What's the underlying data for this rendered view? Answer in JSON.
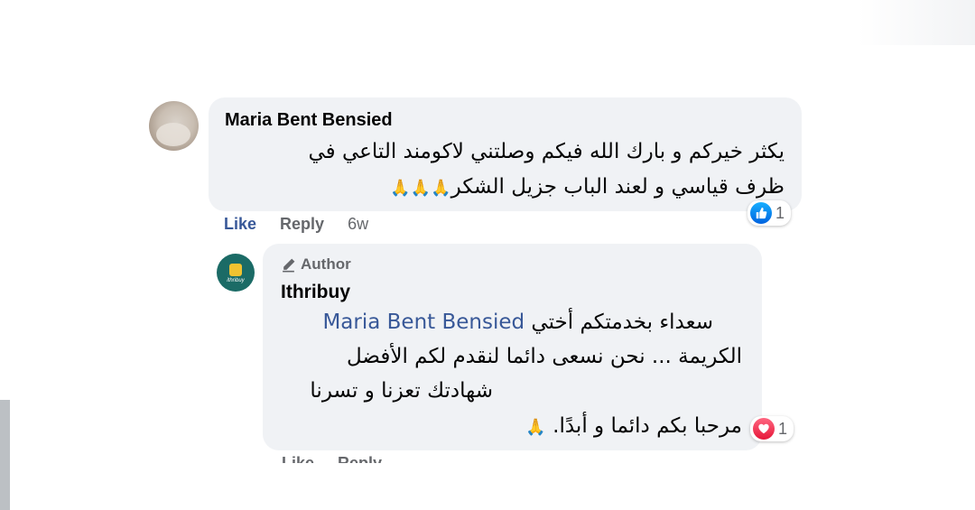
{
  "comments": [
    {
      "author": "Maria Bent Bensied",
      "lines": [
        "يكثر خيركم و بارك الله فيكم وصلتني لاكومند التاعي في",
        "ظرف قياسي و لعند الباب جزيل الشكر"
      ],
      "emoji": "🙏🙏🙏",
      "actions": {
        "like": "Like",
        "reply": "Reply",
        "time": "6w"
      },
      "reaction": {
        "icon": "like-icon",
        "count": "1"
      }
    },
    {
      "badge": "Author",
      "author": "Ithribuy",
      "avatar_brand": "ithribuy",
      "mention": "Maria Bent Bensied",
      "lines": [
        "سعداء بخدمتكم أختي",
        "الكريمة ... نحن نسعى دائما لنقدم لكم الأفضل",
        "شهادتك تعزنا و تسرنا",
        "مرحبا بكم دائما و أبدًا."
      ],
      "emoji": "🙏",
      "actions": {
        "like": "Like",
        "reply": "Reply"
      },
      "reaction": {
        "icon": "love-icon",
        "count": "1"
      }
    }
  ],
  "colors": {
    "bubble": "#f0f2f5",
    "like_blue": "#385898",
    "muted": "#65676b"
  }
}
